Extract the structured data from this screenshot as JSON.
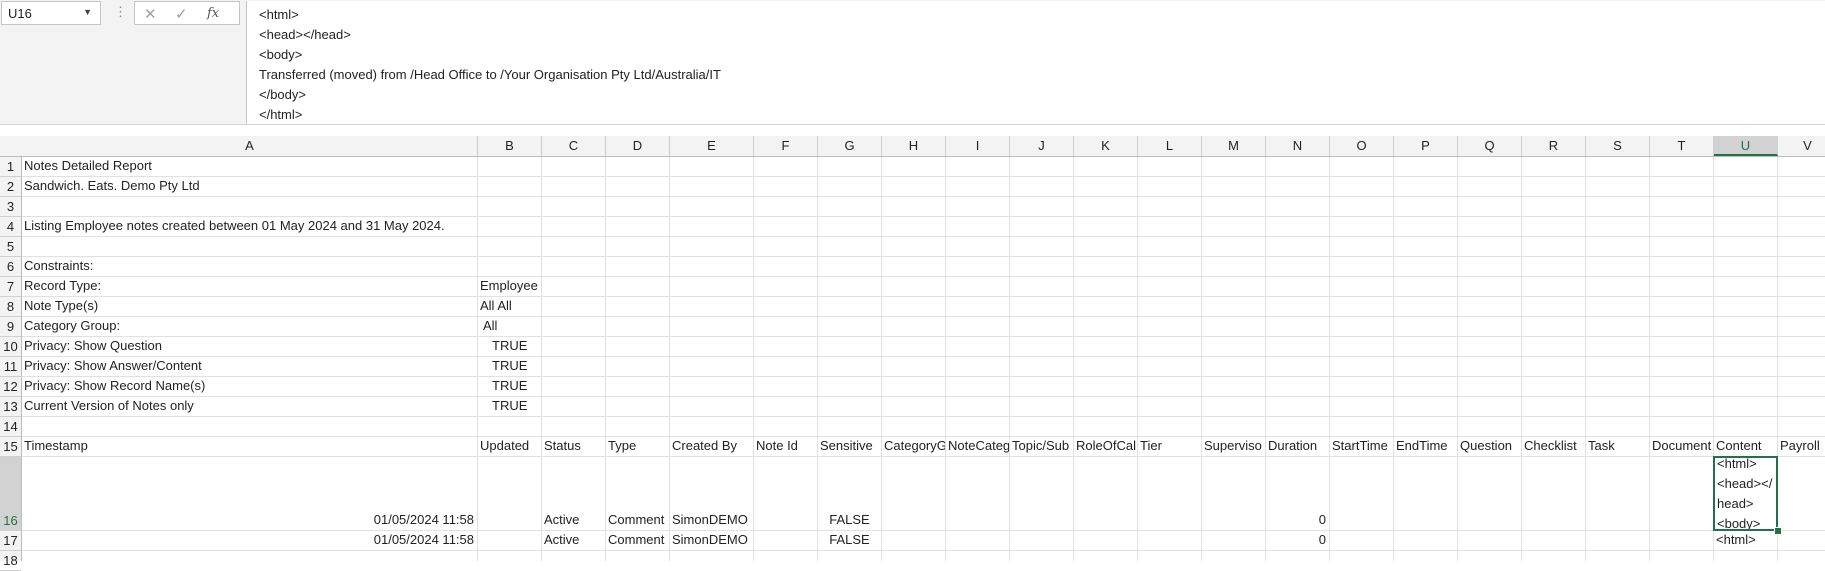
{
  "formula_bar": {
    "cell_ref": "U16",
    "cancel_icon": "close-icon",
    "enter_icon": "check-icon",
    "fx_label": "fx",
    "content_lines": [
      "<html>",
      "<head></head>",
      "<body>",
      "Transferred (moved) from /Head Office to /Your Organisation Pty Ltd/Australia/IT",
      "</body>",
      "</html>"
    ]
  },
  "grid": {
    "columns": [
      "A",
      "B",
      "C",
      "D",
      "E",
      "F",
      "G",
      "H",
      "I",
      "J",
      "K",
      "L",
      "M",
      "N",
      "O",
      "P",
      "Q",
      "R",
      "S",
      "T",
      "U",
      "V"
    ],
    "selected_column": "U",
    "rows": [
      "1",
      "2",
      "3",
      "4",
      "5",
      "6",
      "7",
      "8",
      "9",
      "10",
      "11",
      "12",
      "13",
      "14",
      "15",
      "16",
      "17",
      "18"
    ],
    "selected_row": "16"
  },
  "report": {
    "title": "Notes Detailed Report",
    "company": "Sandwich. Eats. Demo Pty Ltd",
    "listing": "Listing Employee notes created between 01 May 2024 and 31 May 2024.",
    "constraints_label": "Constraints:",
    "constraints": [
      {
        "label": "Record Type:",
        "value": "Employee"
      },
      {
        "label": "Note Type(s)",
        "value": "All All"
      },
      {
        "label": "Category Group:",
        "value": "All"
      },
      {
        "label": "Privacy: Show Question",
        "value": "TRUE"
      },
      {
        "label": "Privacy: Show Answer/Content",
        "value": "TRUE"
      },
      {
        "label": "Privacy: Show Record Name(s)",
        "value": "TRUE"
      },
      {
        "label": "Current Version of Notes only",
        "value": "TRUE"
      }
    ]
  },
  "table": {
    "headers": [
      "Timestamp",
      "Updated",
      "Status",
      "Type",
      "Created By",
      "Note Id",
      "Sensitive",
      "CategoryG",
      "NoteCateg",
      "Topic/Sub",
      "RoleOfCal",
      "Tier",
      "Superviso",
      "Duration",
      "StartTime",
      "EndTime",
      "Question",
      "Checklist",
      "Task",
      "Document",
      "Content",
      "Payroll"
    ],
    "rows": [
      {
        "timestamp": "01/05/2024 11:58",
        "status": "Active",
        "type": "Comment",
        "created_by": "SimonDEMO",
        "sensitive": "FALSE",
        "duration": "0",
        "content_lines": [
          "<html>",
          "<head></",
          "head>",
          "<body>"
        ]
      },
      {
        "timestamp": "01/05/2024 11:58",
        "status": "Active",
        "type": "Comment",
        "created_by": "SimonDEMO",
        "sensitive": "FALSE",
        "duration": "0",
        "content_lines": [
          "<html>"
        ]
      }
    ]
  }
}
